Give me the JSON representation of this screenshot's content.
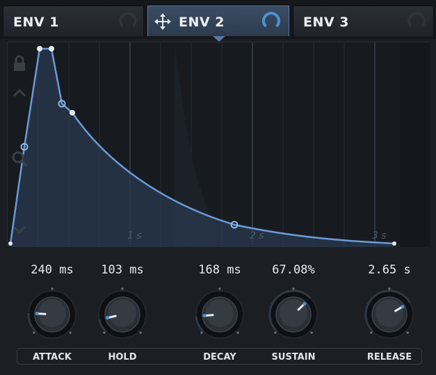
{
  "tabs": [
    {
      "label": "ENV 1",
      "active": false
    },
    {
      "label": "ENV 2",
      "active": true
    },
    {
      "label": "ENV 3",
      "active": false
    }
  ],
  "graph": {
    "time_markers": [
      "1 s",
      "2 s",
      "3 s"
    ],
    "side_icons": [
      "lock-icon",
      "chevron-up-icon",
      "zoom-icon",
      "chevron-down-icon"
    ]
  },
  "knobs": [
    {
      "label": "ATTACK",
      "value": "240 ms",
      "level": 0.18
    },
    {
      "label": "HOLD",
      "value": "103 ms",
      "level": 0.12
    },
    {
      "label": "DECAY",
      "value": "168 ms",
      "level": 0.15
    },
    {
      "label": "SUSTAIN",
      "value": "67.08%",
      "level": 0.67
    },
    {
      "label": "RELEASE",
      "value": "2.65 s",
      "level": 0.72
    }
  ],
  "colors": {
    "accent": "#4f91d6",
    "curve": "#6b9bd8",
    "background": "#1b1e22"
  }
}
